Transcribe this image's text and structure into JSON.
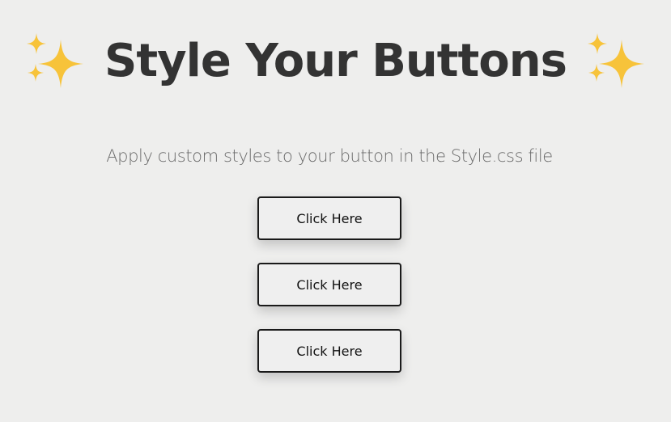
{
  "header": {
    "title": "Style Your Buttons",
    "left_icon": "sparkles-icon",
    "right_icon": "sparkles-icon",
    "icon_color": "#f7c33a"
  },
  "subtitle": "Apply custom styles to your button in the Style.css file",
  "buttons": [
    {
      "label": "Click Here"
    },
    {
      "label": "Click Here"
    },
    {
      "label": "Click Here"
    }
  ],
  "colors": {
    "background": "#eeeeed",
    "title": "#333333",
    "button_border": "#1a1a1a"
  }
}
